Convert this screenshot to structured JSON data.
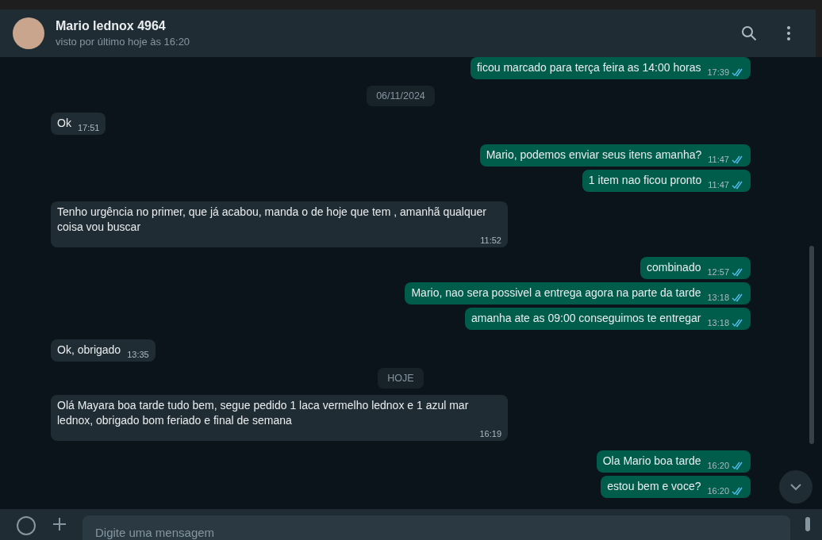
{
  "contact": {
    "name": "Mario lednox 4964",
    "status": "visto por último hoje às 16:20"
  },
  "messages": [
    {
      "kind": "out",
      "text": "ficou marcado para terça feira as 14:00 horas",
      "time": "17:39",
      "read": true
    },
    {
      "kind": "date",
      "text": "06/11/2024"
    },
    {
      "kind": "in",
      "text": "Ok",
      "time": "17:51"
    },
    {
      "kind": "out",
      "text": "Mario, podemos enviar seus itens amanha?",
      "time": "11:47",
      "read": true
    },
    {
      "kind": "out",
      "text": "1 item nao ficou pronto",
      "time": "11:47",
      "read": true
    },
    {
      "kind": "in",
      "text": "Tenho urgência no primer, que já acabou, manda o de hoje que tem , amanhã qualquer coisa vou buscar",
      "time": "11:52"
    },
    {
      "kind": "out",
      "text": "combinado",
      "time": "12:57",
      "read": true
    },
    {
      "kind": "out",
      "text": "Mario, nao sera possivel a entrega agora na parte da tarde",
      "time": "13:18",
      "read": true
    },
    {
      "kind": "out",
      "text": "amanha ate as 09:00 conseguimos te entregar",
      "time": "13:18",
      "read": true
    },
    {
      "kind": "in",
      "text": "Ok, obrigado",
      "time": "13:35"
    },
    {
      "kind": "date",
      "text": "HOJE"
    },
    {
      "kind": "in",
      "text": "Olá Mayara boa tarde tudo bem, segue pedido 1 laca vermelho lednox e 1 azul mar lednox, obrigado bom feriado e final de semana",
      "time": "16:19"
    },
    {
      "kind": "out",
      "text": "Ola Mario boa tarde",
      "time": "16:20",
      "read": true
    },
    {
      "kind": "out",
      "text": "estou bem e voce?",
      "time": "16:20",
      "read": true
    }
  ],
  "composer": {
    "placeholder": "Digite uma mensagem"
  }
}
